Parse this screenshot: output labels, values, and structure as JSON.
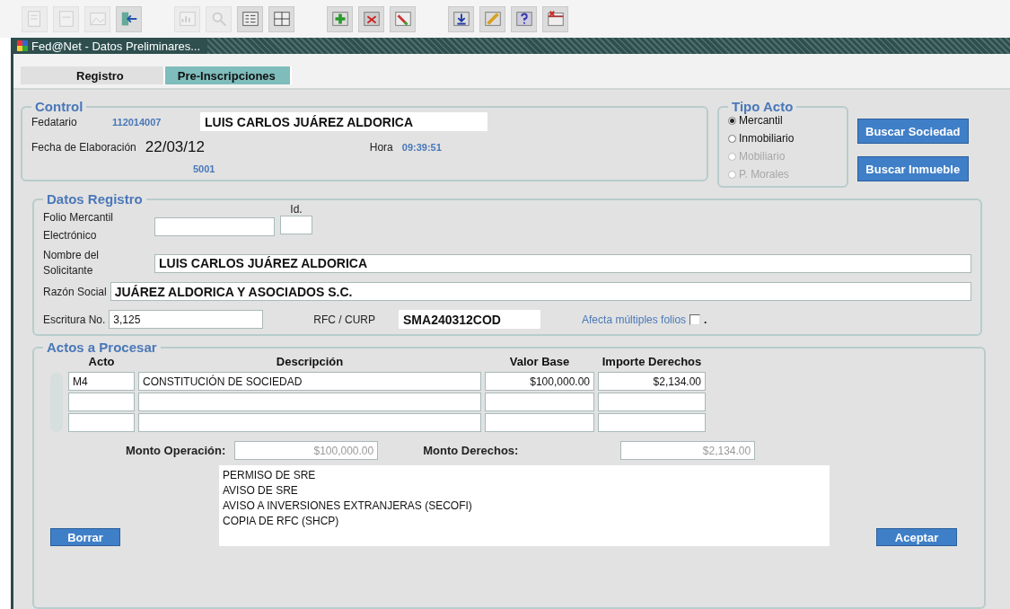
{
  "toolbar": {
    "groups": [
      [
        {
          "disabled": true
        },
        {
          "disabled": true
        },
        {
          "disabled": true
        },
        {
          "disabled": false
        }
      ],
      [
        {
          "disabled": true
        },
        {
          "disabled": true
        },
        {
          "disabled": false
        },
        {
          "disabled": false
        }
      ],
      [
        {
          "disabled": false
        },
        {
          "disabled": false
        },
        {
          "disabled": false
        }
      ],
      [
        {
          "disabled": false
        },
        {
          "disabled": false
        },
        {
          "disabled": false
        },
        {
          "disabled": false
        }
      ]
    ]
  },
  "window": {
    "title": "Fed@Net - Datos Preliminares..."
  },
  "tabs": [
    {
      "label": "Registro",
      "selected": false
    },
    {
      "label": "Pre-Inscripciones",
      "selected": true
    }
  ],
  "control": {
    "legend": "Control",
    "fedatario_label": "Fedatario",
    "fedatario_id": "112014007",
    "fedatario_name": "LUIS CARLOS JUÁREZ ALDORICA",
    "fecha_label": "Fecha de Elaboración",
    "fecha": "22/03/12",
    "hora_label": "Hora",
    "hora": "09:39:51",
    "code": "5001"
  },
  "tipo_acto": {
    "legend": "Tipo Acto",
    "options": [
      {
        "label": "Mercantil",
        "selected": true,
        "disabled": false
      },
      {
        "label": "Inmobiliario",
        "selected": false,
        "disabled": false
      },
      {
        "label": "Mobiliario",
        "selected": false,
        "disabled": true
      },
      {
        "label": "P. Morales",
        "selected": false,
        "disabled": true
      }
    ]
  },
  "side_buttons": [
    "Buscar Sociedad",
    "Buscar Inmueble"
  ],
  "datos_registro": {
    "legend": "Datos Registro",
    "folio_label": "Folio Mercantil Electrónico",
    "id_label": "Id.",
    "nombre_label": "Nombre del Solicitante",
    "nombre": "LUIS CARLOS JUÁREZ ALDORICA",
    "razon_label": "Razón Social",
    "razon": "JUÁREZ ALDORICA Y ASOCIADOS S.C.",
    "escritura_label": "Escritura No.",
    "escritura": "3,125",
    "rfc_label": "RFC / CURP",
    "rfc": "SMA240312COD",
    "afecta_label": "Afecta múltiples folios",
    "afecta_checked": false,
    "afecta_suffix": "."
  },
  "actos": {
    "legend": "Actos a Procesar",
    "columns": [
      "Acto",
      "Descripción",
      "Valor Base",
      "Importe Derechos"
    ],
    "rows": [
      {
        "cells": [
          "M4",
          "CONSTITUCIÓN DE SOCIEDAD",
          "$100,000.00",
          "$2,134.00"
        ]
      }
    ],
    "monto_operacion_label": "Monto Operación:",
    "monto_operacion": "$100,000.00",
    "monto_derechos_label": "Monto Derechos:",
    "monto_derechos": "$2,134.00",
    "requirements": [
      "PERMISO DE SRE",
      "AVISO DE SRE",
      "AVISO A INVERSIONES EXTRANJERAS (SECOFI)",
      "COPIA DE RFC (SHCP)"
    ]
  },
  "bottom_buttons": [
    "Borrar",
    "Aceptar"
  ]
}
